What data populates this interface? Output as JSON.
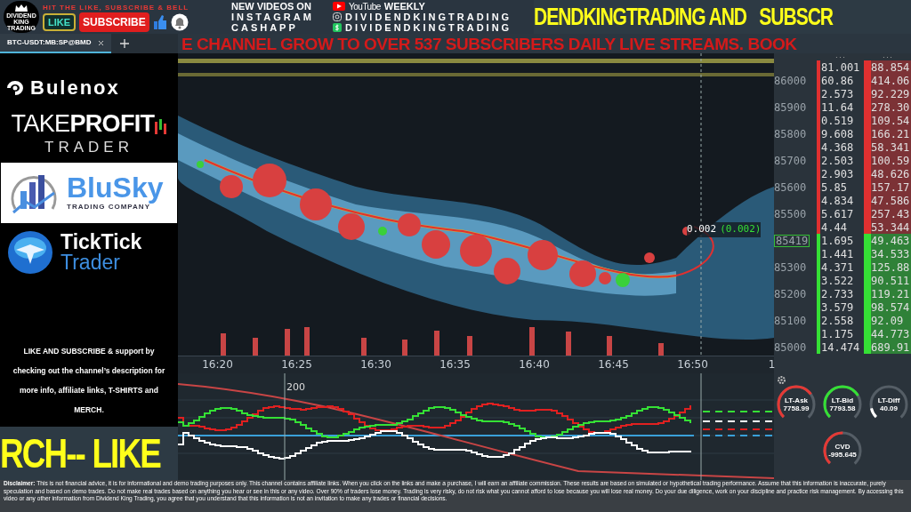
{
  "banner": {
    "logo_text": "DIVIDEND KING TRADING",
    "call_to_action": "HIT THE LIKE, SUBSCRIBE & BELL",
    "like_label": "LIKE",
    "subscribe_label": "SUBSCRIBE",
    "info_rows": [
      {
        "label": "NEW VIDEOS ON",
        "brand": "YouTube",
        "value": "WEEKLY",
        "kind": "youtube"
      },
      {
        "label": "INSTAGRAM",
        "value": "DIVIDENDKINGTRADING",
        "kind": "instagram"
      },
      {
        "label": "CASHAPP",
        "value": "DIVIDENDKINGTRADING",
        "kind": "cashapp"
      }
    ],
    "scroll_text": "DENDKINGTRADING AND   SUBSCR"
  },
  "tabs": [
    {
      "label": "BTC-USDT:MB:SP@BMD",
      "selected": true
    }
  ],
  "ticker": "E CHANNEL GROW TO OVER 537 SUBSCRIBERS DAILY LIVE STREAMS. BOOK",
  "sponsors": {
    "bulenox": "Bulenox",
    "takeprofit": "TAKE**PROFIT**",
    "takeprofit_sub": "TRADER",
    "blusky": "BluSky",
    "blusky_sub": "TRADING COMPANY",
    "ticktick": "TickTick",
    "ticktick_sub": "Trader",
    "message": "LIKE AND SUBSCRIBE & support by checking out the channel’s description for more info, affiliate links, T-SHIRTS and MERCH.",
    "footer_scroll": "RCH-- LIKE"
  },
  "chart": {
    "last_trade": "0.002",
    "last_trade_total": "(0.002)",
    "time_labels": [
      "16:20",
      "16:25",
      "16:30",
      "16:35",
      "16:40",
      "16:45",
      "16:50",
      "1"
    ]
  },
  "order_book": {
    "column_headers": [
      "...",
      "..."
    ],
    "asks": [
      {
        "size": "81.001",
        "total": "88.854"
      },
      {
        "price": "86000",
        "size": "60.86",
        "total": "414.06"
      },
      {
        "size": "2.573",
        "total": "92.229"
      },
      {
        "price": "85900",
        "size": "11.64",
        "total": "278.30"
      },
      {
        "size": "0.519",
        "total": "109.54"
      },
      {
        "price": "85800",
        "size": "9.608",
        "total": "166.21"
      },
      {
        "size": "4.368",
        "total": "58.341"
      },
      {
        "price": "85700",
        "size": "2.503",
        "total": "100.59"
      },
      {
        "size": "2.903",
        "total": "48.626"
      },
      {
        "price": "85600",
        "size": "5.85",
        "total": "157.17"
      },
      {
        "size": "4.834",
        "total": "47.586"
      },
      {
        "price": "85500",
        "size": "5.617",
        "total": "257.43"
      },
      {
        "size": "4.44",
        "total": "53.344"
      }
    ],
    "current_price": "85419",
    "bids": [
      {
        "size": "1.695",
        "total": "49.463"
      },
      {
        "size": "1.441",
        "total": "34.533"
      },
      {
        "price": "85300",
        "size": "4.371",
        "total": "125.88"
      },
      {
        "size": "3.522",
        "total": "90.511"
      },
      {
        "price": "85200",
        "size": "2.733",
        "total": "119.21"
      },
      {
        "size": "3.579",
        "total": "98.574"
      },
      {
        "price": "85100",
        "size": "2.558",
        "total": "92.09"
      },
      {
        "size": "1.175",
        "total": "44.773"
      },
      {
        "price": "85000",
        "size": "14.474",
        "total": "689.91"
      }
    ]
  },
  "indicator_pane": {
    "scale_label": "200"
  },
  "gauges": [
    {
      "label": "LT-Ask",
      "value": "7758.99",
      "color": "#e53935"
    },
    {
      "label": "LT-Bid",
      "value": "7793.58",
      "color": "#35e035"
    },
    {
      "label": "LT-Diff",
      "value": "40.09",
      "color": "#ffffff"
    },
    {
      "label": "CVD",
      "value": "-995.645",
      "color": "#e53935"
    }
  ],
  "disclaimer": "**Disclaimer:** This is not financial advice, it is for informational and demo trading purposes only. This channel contains affiliate links. When you click on the links and make a purchase, I will earn an affiliate commission. These results are based on simulated or hypothetical trading performance. Assume that this information is inaccurate, purely speculation and based on demo trades. Do not make real trades based on anything you hear or see in this or any video. Over 90% of traders lose money. Trading is very risky, do not risk what you cannot afford to lose because you will lose real money. Do your due diligence, work on your discipline and practice risk management. By accessing this video or any other information from Dividend King Trading, you agree that you understand that this information is not an invitation to make any trades or financial decisions."
}
